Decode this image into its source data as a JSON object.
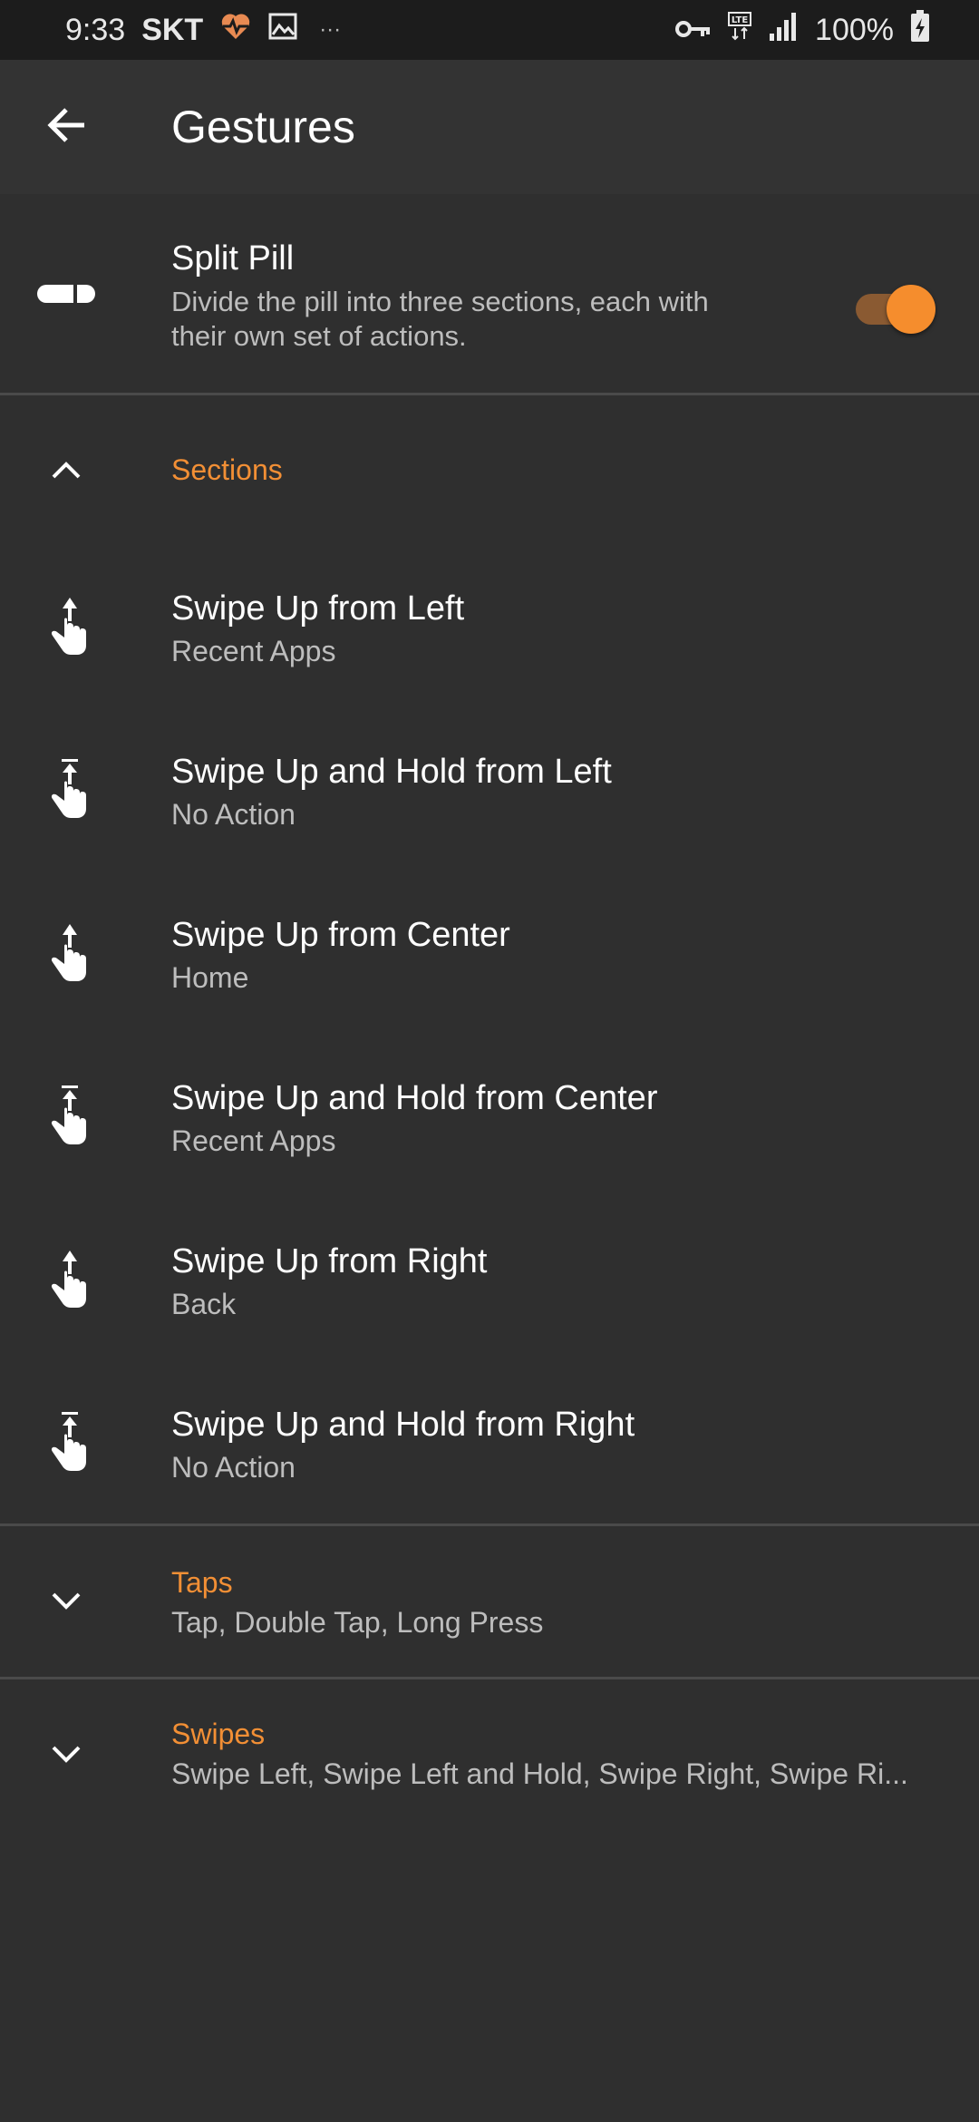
{
  "status_bar": {
    "time": "9:33",
    "carrier": "SKT",
    "dots": "···",
    "battery_text": "100%",
    "icons": [
      "heart-rate-icon",
      "image-icon",
      "vpn-key-icon",
      "lte-icon",
      "signal-icon",
      "battery-charging-icon"
    ]
  },
  "app_bar": {
    "title": "Gestures",
    "back_icon": "arrow-left-icon"
  },
  "split_pill": {
    "title": "Split Pill",
    "subtitle_line1": "Divide the pill into three sections, each with",
    "subtitle_line2": "their own set of actions.",
    "enabled": true,
    "accent": "#f58d2d"
  },
  "sections": {
    "header": "Sections",
    "expanded": true,
    "items": [
      {
        "title": "Swipe Up from Left",
        "value": "Recent Apps",
        "icon": "swipe-up-icon"
      },
      {
        "title": "Swipe Up and Hold from Left",
        "value": "No Action",
        "icon": "swipe-up-hold-icon"
      },
      {
        "title": "Swipe Up from Center",
        "value": "Home",
        "icon": "swipe-up-icon"
      },
      {
        "title": "Swipe Up and Hold from Center",
        "value": "Recent Apps",
        "icon": "swipe-up-hold-icon"
      },
      {
        "title": "Swipe Up from Right",
        "value": "Back",
        "icon": "swipe-up-icon"
      },
      {
        "title": "Swipe Up and Hold from Right",
        "value": "No Action",
        "icon": "swipe-up-hold-icon"
      }
    ]
  },
  "taps": {
    "header": "Taps",
    "summary": "Tap, Double Tap, Long Press",
    "expanded": false
  },
  "swipes": {
    "header": "Swipes",
    "summary": "Swipe Left, Swipe Left and Hold, Swipe Right, Swipe Ri...",
    "expanded": false
  },
  "colors": {
    "background": "#2f2f2f",
    "accent": "#f28f35",
    "status_bar": "#1c1c1c"
  }
}
